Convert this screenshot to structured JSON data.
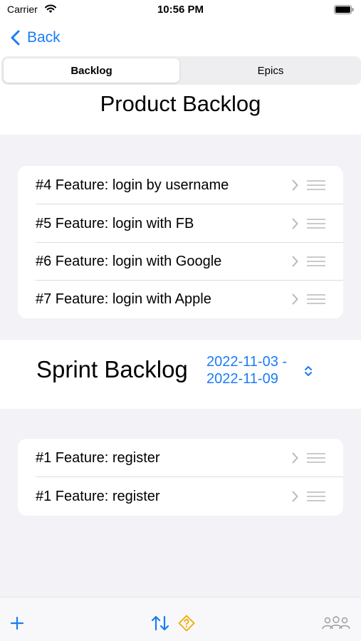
{
  "status_bar": {
    "carrier": "Carrier",
    "time": "10:56 PM"
  },
  "nav": {
    "back_label": "Back"
  },
  "segments": {
    "items": [
      {
        "label": "Backlog",
        "selected": true
      },
      {
        "label": "Epics",
        "selected": false
      }
    ]
  },
  "product_backlog": {
    "title": "Product Backlog",
    "items": [
      {
        "label": "#4  Feature: login by username"
      },
      {
        "label": "#5  Feature: login with FB"
      },
      {
        "label": "#6  Feature: login with Google"
      },
      {
        "label": "#7  Feature: login with Apple"
      }
    ]
  },
  "sprint_backlog": {
    "title": "Sprint Backlog",
    "date_start": "2022-11-03 -",
    "date_end": "2022-11-09",
    "items": [
      {
        "label": "#1  Feature: register"
      },
      {
        "label": "#1  Feature: register"
      }
    ]
  },
  "toolbar": {
    "icons": [
      "plus-icon",
      "sort-icon",
      "help-diamond-icon",
      "people-icon"
    ]
  },
  "colors": {
    "accent": "#1a7cf5",
    "warning": "#f2a900",
    "grouped_background": "#f2f2f7"
  }
}
